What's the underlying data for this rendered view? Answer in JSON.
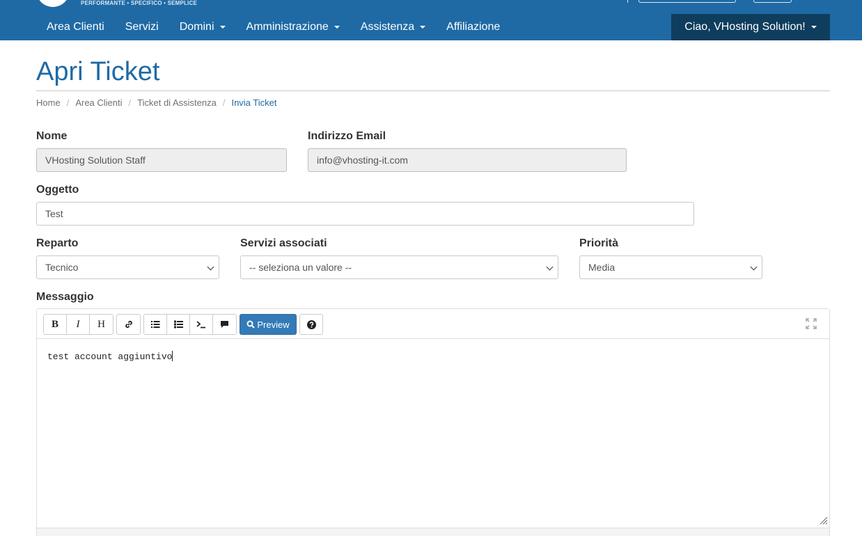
{
  "header": {
    "tagline": "PERFORMANTE • SPECIFICO • SEMPLICE",
    "nav": [
      {
        "label": "Area Clienti",
        "dropdown": false
      },
      {
        "label": "Servizi",
        "dropdown": false
      },
      {
        "label": "Domini",
        "dropdown": true
      },
      {
        "label": "Amministrazione",
        "dropdown": true
      },
      {
        "label": "Assistenza",
        "dropdown": true
      },
      {
        "label": "Affiliazione",
        "dropdown": false
      }
    ],
    "user_menu": "Ciao, VHosting Solution!"
  },
  "page": {
    "title": "Apri Ticket"
  },
  "breadcrumb": [
    "Home",
    "Area Clienti",
    "Ticket di Assistenza",
    "Invia Ticket"
  ],
  "form": {
    "name_label": "Nome",
    "name_value": "VHosting Solution Staff",
    "email_label": "Indirizzo Email",
    "email_value": "info@vhosting-it.com",
    "subject_label": "Oggetto",
    "subject_value": "Test",
    "department_label": "Reparto",
    "department_value": "Tecnico",
    "services_label": "Servizi associati",
    "services_value": "-- seleziona un valore --",
    "priority_label": "Priorità",
    "priority_value": "Media",
    "message_label": "Messaggio"
  },
  "editor": {
    "preview_label": "Preview",
    "content": "test account aggiuntivo",
    "bold_glyph": "B",
    "italic_glyph": "I",
    "heading_glyph": "H"
  },
  "colors": {
    "header_bg": "#1f6aa5",
    "user_menu_bg": "#0f3d5e",
    "title": "#1f6aa5",
    "primary_button": "#337ab7"
  }
}
